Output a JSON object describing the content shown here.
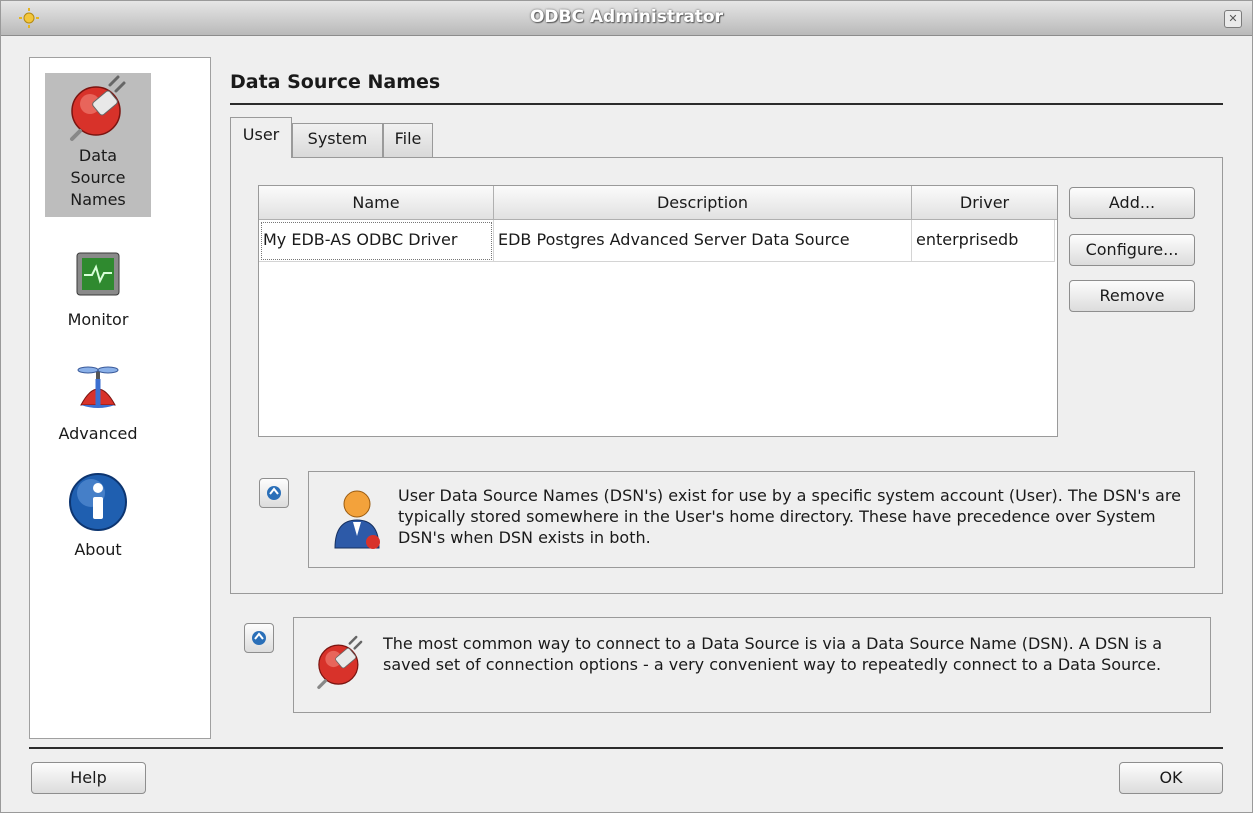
{
  "window": {
    "title": "ODBC Administrator"
  },
  "sidebar": {
    "items": [
      {
        "label_lines": [
          "Data",
          "Source",
          "Names"
        ],
        "icon": "plug-icon",
        "selected": true
      },
      {
        "label_lines": [
          "Monitor"
        ],
        "icon": "monitor-icon",
        "selected": false
      },
      {
        "label_lines": [
          "Advanced"
        ],
        "icon": "propeller-hat-icon",
        "selected": false
      },
      {
        "label_lines": [
          "About"
        ],
        "icon": "info-icon",
        "selected": false
      }
    ]
  },
  "page": {
    "title": "Data Source Names"
  },
  "tabs": [
    {
      "label": "User",
      "active": true
    },
    {
      "label": "System",
      "active": false
    },
    {
      "label": "File",
      "active": false
    }
  ],
  "table": {
    "columns": [
      "Name",
      "Description",
      "Driver"
    ],
    "rows": [
      [
        "My EDB-AS ODBC Driver",
        "EDB Postgres Advanced Server Data Source",
        "enterprisedb"
      ]
    ]
  },
  "actions": {
    "add_label": "Add...",
    "configure_label": "Configure...",
    "remove_label": "Remove"
  },
  "user_info": {
    "icon": "user-icon",
    "text": "User Data Source Names (DSN's) exist for use by a specific system account (User). The DSN's are typically stored somewhere in the User's home directory. These have precedence over System DSN's when DSN exists in both."
  },
  "dsn_info": {
    "icon": "plug-icon",
    "text": "The most common way to connect to a Data Source is via a Data Source Name (DSN). A DSN is a saved set of connection options - a very convenient way to repeatedly connect to a Data Source."
  },
  "footer": {
    "help_label": "Help",
    "ok_label": "OK"
  },
  "colors": {
    "selected_bg": "#bdbdbd",
    "info_blue": "#2a6fb8",
    "plug_red": "#d8322a"
  }
}
